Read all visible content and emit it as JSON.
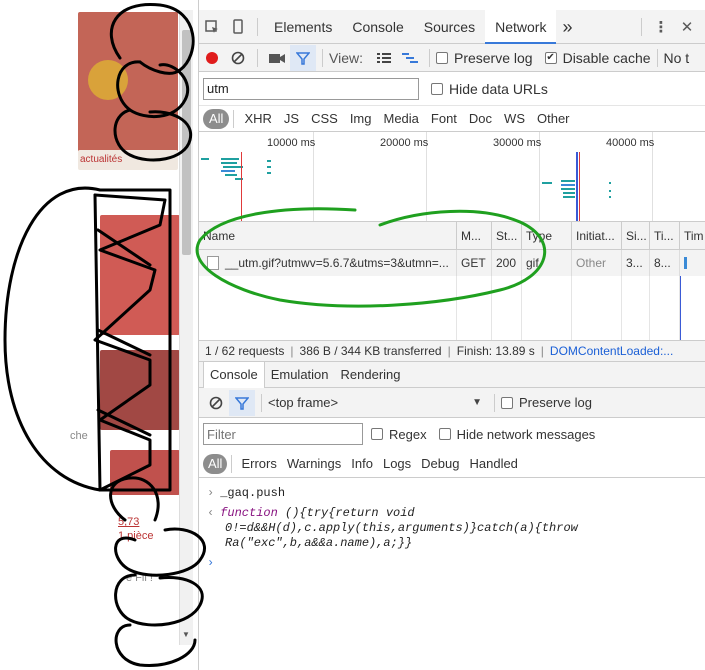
{
  "page": {
    "bg_texts": [
      "actualités",
      "5,73",
      "1 pièce",
      "e Fil !",
      "che"
    ],
    "colors": {
      "accent": "#3879d9",
      "record": "#e01c1c",
      "filter": "#3879d9",
      "link": "#1a5fd6",
      "marker": "#1fa01f"
    }
  },
  "devtools": {
    "tabs": [
      "Elements",
      "Console",
      "Sources",
      "Network"
    ],
    "active_tab": "Network",
    "more_tabs": "»",
    "menu_icon": "⋮",
    "close_icon": "✕"
  },
  "network_toolbar": {
    "view_label": "View:",
    "preserve_log": "Preserve log",
    "disable_cache": "Disable cache",
    "throttle": "No t"
  },
  "filter": {
    "value": "utm",
    "hide_data_urls": "Hide data URLs",
    "types": [
      "All",
      "XHR",
      "JS",
      "CSS",
      "Img",
      "Media",
      "Font",
      "Doc",
      "WS",
      "Other"
    ],
    "active_type": "All"
  },
  "overview": {
    "ticks": [
      "10000 ms",
      "20000 ms",
      "30000 ms",
      "40000 ms"
    ]
  },
  "requests": {
    "columns": [
      "Name",
      "M...",
      "St...",
      "Type",
      "Initiat...",
      "Si...",
      "Ti...",
      "Tim"
    ],
    "rows": [
      {
        "name": "__utm.gif?utmwv=5.6.7&utms=3&utmn=...",
        "method": "GET",
        "status": "200",
        "type": "gif",
        "initiator": "Other",
        "size": "3...",
        "time": "8..."
      }
    ]
  },
  "status": {
    "requests": "1 / 62 requests",
    "transferred": "386 B / 344 KB transferred",
    "finish": "Finish: 13.89 s",
    "dcl": "DOMContentLoaded:..."
  },
  "drawer": {
    "tabs": [
      "Console",
      "Emulation",
      "Rendering"
    ],
    "active_tab": "Console",
    "frame": "<top frame>",
    "preserve_log": "Preserve log",
    "filter_placeholder": "Filter",
    "regex": "Regex",
    "hide_network": "Hide network messages",
    "levels": [
      "All",
      "Errors",
      "Warnings",
      "Info",
      "Logs",
      "Debug",
      "Handled"
    ],
    "active_level": "All"
  },
  "console": {
    "input_line": "_gaq.push",
    "result_keyword": "function",
    "result_line1": " (){try{return void",
    "result_line2": "0!=d&&H(d),c.apply(this,arguments)}catch(a){throw",
    "result_line3": "Ra(\"exc\",b,a&&a.name),a;}}"
  }
}
